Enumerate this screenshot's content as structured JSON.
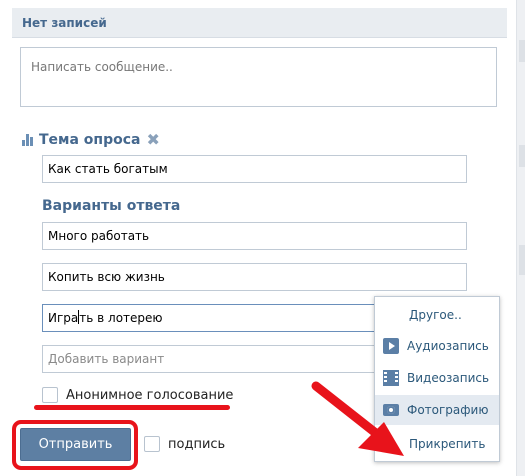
{
  "header": {
    "title": "Нет записей"
  },
  "compose": {
    "placeholder": "Написать сообщение.."
  },
  "poll": {
    "title_label": "Тема опроса",
    "question": "Как стать богатым",
    "answers_label": "Варианты ответа",
    "answers": [
      "Много работать",
      "Копить всю жизнь",
      "Играть в лотерею"
    ],
    "add_placeholder": "Добавить вариант",
    "anonymous_label": "Анонимное голосование"
  },
  "footer": {
    "send_label": "Отправить",
    "sign_label": "подпись"
  },
  "attach_menu": {
    "items": [
      {
        "label": "Другое..",
        "icon": "none"
      },
      {
        "label": "Аудиозапись",
        "icon": "audio-icon"
      },
      {
        "label": "Видеозапись",
        "icon": "video-icon"
      },
      {
        "label": "Фотографию",
        "icon": "photo-icon"
      },
      {
        "label": "Прикрепить",
        "icon": "none"
      }
    ]
  },
  "colors": {
    "accent": "#45688e",
    "button": "#5d7fa3",
    "annotation_red": "#e8131b"
  }
}
